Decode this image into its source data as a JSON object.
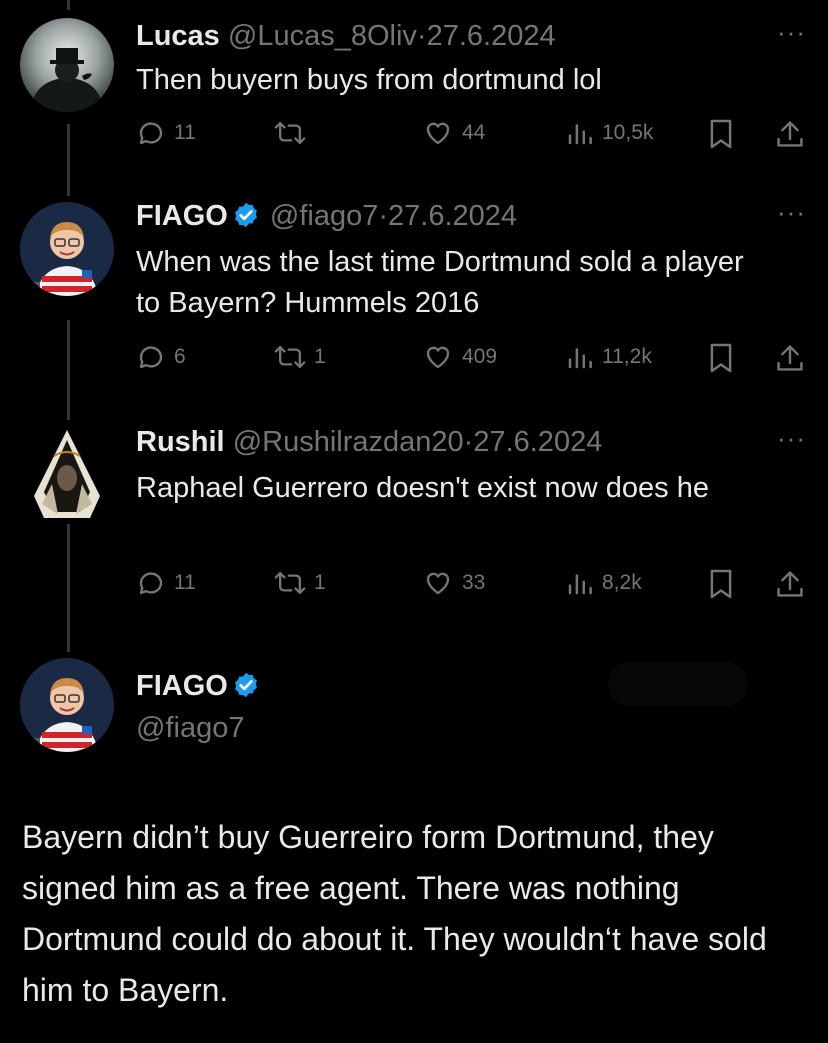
{
  "tweets": [
    {
      "name": "Lucas",
      "handle": "@Lucas_8Oliv",
      "sep": "·",
      "date": "27.6.2024",
      "verified": false,
      "text": "Then buyern buys from dortmund lol",
      "replies": "11",
      "reposts": "",
      "likes": "44",
      "views": "10,5k"
    },
    {
      "name": "FIAGO",
      "handle": "@fiago7",
      "sep": "·",
      "date": "27.6.2024",
      "verified": true,
      "text": "When was the last time Dortmund sold a player to Bayern? Hummels 2016",
      "replies": "6",
      "reposts": "1",
      "likes": "409",
      "views": "11,2k"
    },
    {
      "name": "Rushil",
      "handle": "@Rushilrazdan20",
      "sep": "·",
      "date": "27.6.2024",
      "verified": false,
      "text": "Raphael Guerrero doesn't exist now does he",
      "replies": "11",
      "reposts": "1",
      "likes": "33",
      "views": "8,2k"
    }
  ],
  "main_tweet": {
    "name": "FIAGO",
    "handle": "@fiago7",
    "verified": true,
    "text": "Bayern didn’t buy Guerreiro form Dortmund, they signed him as a free agent. There was nothing Dortmund could do about it. They wouldn‘t have sold him to Bayern."
  },
  "more_glyph": "···",
  "colors": {
    "background": "#000000",
    "text": "#e7e9ea",
    "muted": "#71767b",
    "verified": "#1d9bf0",
    "thread_line": "#333639"
  },
  "icons": [
    "reply-icon",
    "repost-icon",
    "like-icon",
    "views-icon",
    "bookmark-icon",
    "share-icon",
    "verified-icon",
    "more-icon"
  ]
}
